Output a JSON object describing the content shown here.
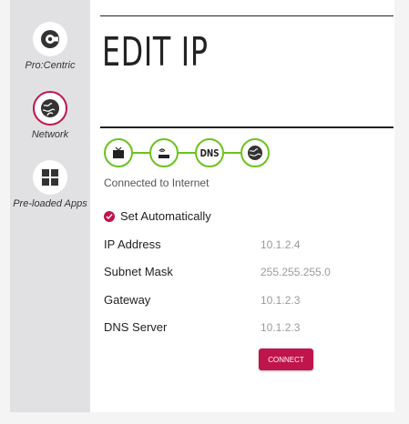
{
  "sidebar": {
    "items": [
      {
        "label": "Pro:Centric",
        "icon": "pro-centric-icon"
      },
      {
        "label": "Network",
        "icon": "globe-icon",
        "active": true
      },
      {
        "label": "Pre-loaded Apps",
        "icon": "apps-grid-icon"
      }
    ]
  },
  "page": {
    "title": "EDIT IP"
  },
  "steps": [
    {
      "icon": "tv-icon"
    },
    {
      "icon": "router-icon"
    },
    {
      "label": "DNS"
    },
    {
      "icon": "globe-icon"
    }
  ],
  "status_text": "Connected to Internet",
  "set_automatically": {
    "label": "Set Automatically",
    "checked": true
  },
  "fields": [
    {
      "label": "IP Address",
      "value": "10.1.2.4"
    },
    {
      "label": "Subnet Mask",
      "value": "255.255.255.0"
    },
    {
      "label": "Gateway",
      "value": "10.1.2.3"
    },
    {
      "label": "DNS Server",
      "value": "10.1.2.3"
    }
  ],
  "connect_button": {
    "label": "CONNECT"
  },
  "colors": {
    "accent": "#c0144c",
    "step_green": "#6cc21f",
    "sidebar_bg": "#e1e1e4"
  }
}
